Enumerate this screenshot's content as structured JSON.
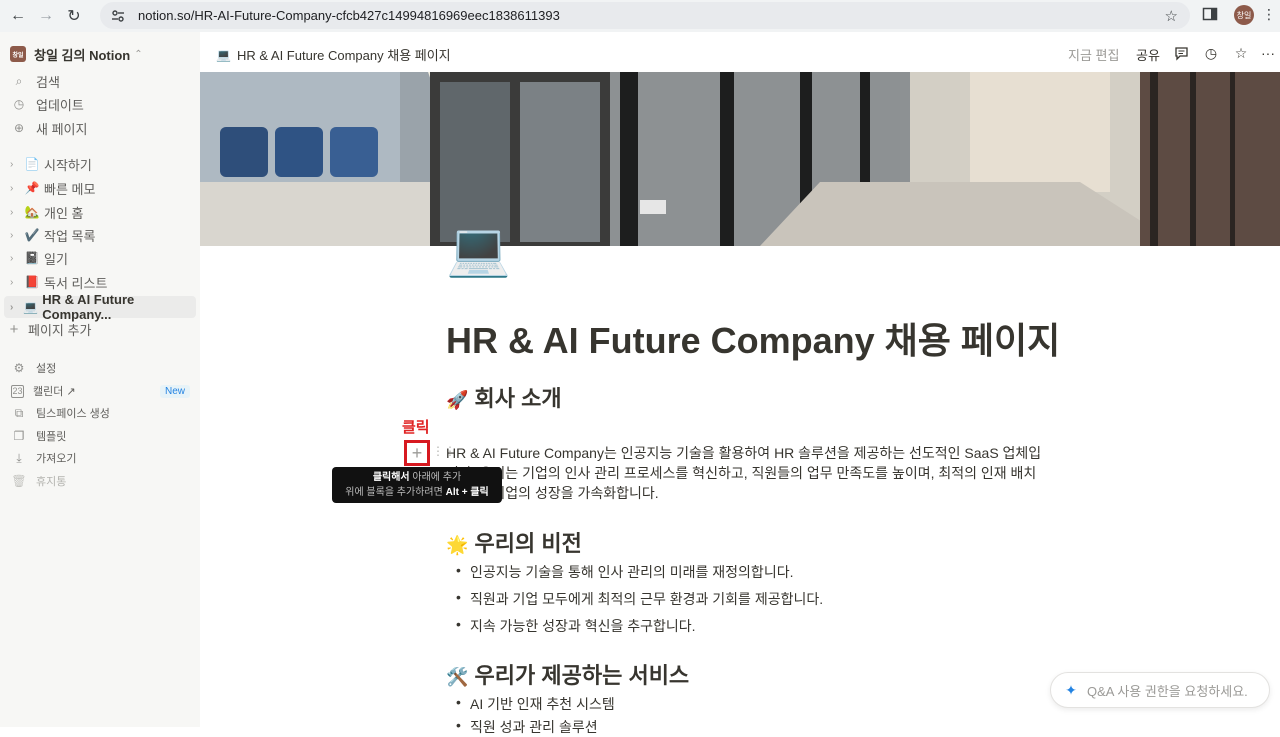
{
  "browser": {
    "url": "notion.so/HR-AI-Future-Company-cfcb427c14994816969eec1838611393",
    "profile_initials": "창일"
  },
  "sidebar": {
    "workspace": "창일 김의 Notion",
    "workspace_badge": "창일",
    "top_items": [
      {
        "label": "검색",
        "icon": "search-icon"
      },
      {
        "label": "업데이트",
        "icon": "clock-icon"
      },
      {
        "label": "새 페이지",
        "icon": "plus-circle-icon"
      }
    ],
    "pages": [
      {
        "label": "시작하기",
        "emoji": "📄"
      },
      {
        "label": "빠른 메모",
        "emoji": "📌"
      },
      {
        "label": "개인 홈",
        "emoji": "🏡"
      },
      {
        "label": "작업 목록",
        "emoji": "✔️"
      },
      {
        "label": "일기",
        "emoji": "📓"
      },
      {
        "label": "독서 리스트",
        "emoji": "📕"
      },
      {
        "label": "HR & AI Future Company...",
        "emoji": "💻"
      }
    ],
    "add_page": "페이지 추가",
    "bottom_items": [
      {
        "label": "설정",
        "icon": "gear-icon"
      },
      {
        "label": "캘린더 ↗",
        "icon": "calendar-icon",
        "badge": "New"
      },
      {
        "label": "팀스페이스 생성",
        "icon": "teamspace-icon"
      },
      {
        "label": "템플릿",
        "icon": "template-icon"
      },
      {
        "label": "가져오기",
        "icon": "import-icon"
      },
      {
        "label": "휴지통",
        "icon": "trash-icon"
      }
    ]
  },
  "topbar": {
    "breadcrumb": "HR & AI Future Company 채용 페이지",
    "breadcrumb_emoji": "💻",
    "edit_label": "지금 편집",
    "share_label": "공유"
  },
  "page": {
    "icon": "💻",
    "title": "HR & AI Future Company 채용 페이지",
    "sections": [
      {
        "emoji": "🚀",
        "heading": "회사 소개"
      },
      {
        "emoji": "🌟",
        "heading": "우리의 비전"
      },
      {
        "emoji": "🛠️",
        "heading": "우리가 제공하는 서비스"
      }
    ],
    "intro_paragraph": "HR & AI Future Company는 인공지능 기술을 활용하여 HR 솔루션을 제공하는 선도적인 SaaS 업체입니다. 우리는 기업의 인사 관리 프로세스를 혁신하고, 직원들의 업무 만족도를 높이며, 최적의 인재 배치를 통해 기업의 성장을 가속화합니다.",
    "vision_bullets": [
      "인공지능 기술을 통해 인사 관리의 미래를 재정의합니다.",
      "직원과 기업 모두에게 최적의 근무 환경과 기회를 제공합니다.",
      "지속 가능한 성장과 혁신을 추구합니다."
    ],
    "service_bullets": [
      "AI 기반 인재 추천 시스템",
      "직원 성과 관리 솔루션"
    ]
  },
  "annotation": {
    "click_label": "클릭",
    "plus": "+"
  },
  "tooltip": {
    "line1_bold": "클릭해서",
    "line1_rest": " 아래에 추가",
    "line2_rest": "위에 블록을 추가하려면 ",
    "line2_bold": "Alt + 클릭"
  },
  "qa": {
    "placeholder": "Q&A 사용 권한을 요청하세요."
  }
}
